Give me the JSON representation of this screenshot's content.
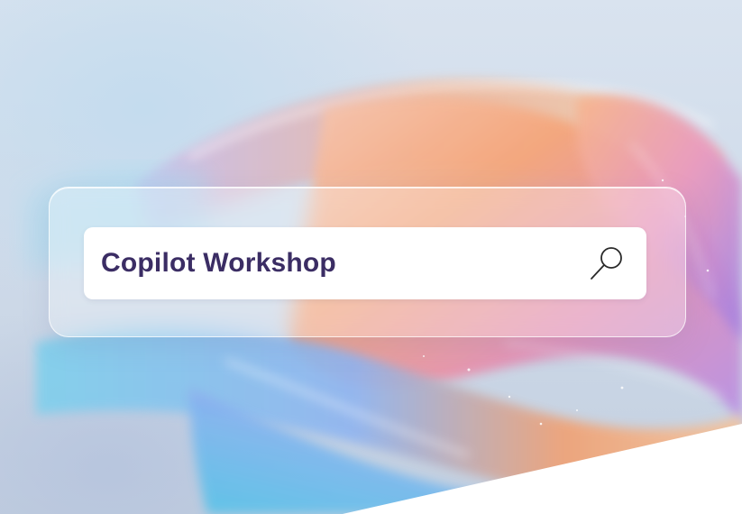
{
  "search": {
    "query": "Copilot Workshop",
    "icon": "search-icon"
  },
  "colors": {
    "text": "#3b2d64",
    "icon": "#2a2a2a",
    "bar_background": "#ffffff",
    "background": "#cfdbea"
  }
}
